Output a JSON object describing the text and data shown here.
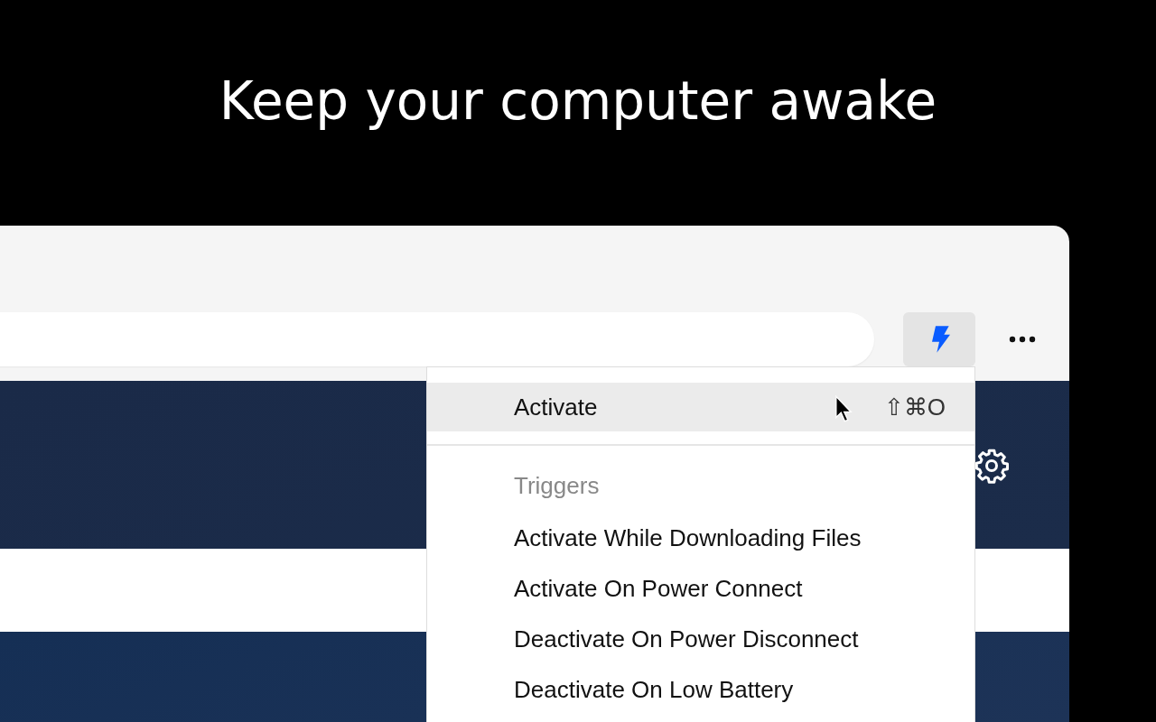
{
  "headline": "Keep your computer awake",
  "menu": {
    "items": [
      {
        "kind": "item",
        "label": "Activate",
        "shortcut": "⇧⌘O",
        "highlighted": true
      },
      {
        "kind": "separator"
      },
      {
        "kind": "header",
        "label": "Triggers"
      },
      {
        "kind": "item",
        "label": "Activate While Downloading Files",
        "highlighted": false
      },
      {
        "kind": "item",
        "label": "Activate On Power Connect",
        "highlighted": false
      },
      {
        "kind": "item",
        "label": "Deactivate On Power Disconnect",
        "highlighted": false
      },
      {
        "kind": "item",
        "label": "Deactivate On Low Battery",
        "highlighted": false
      }
    ]
  }
}
